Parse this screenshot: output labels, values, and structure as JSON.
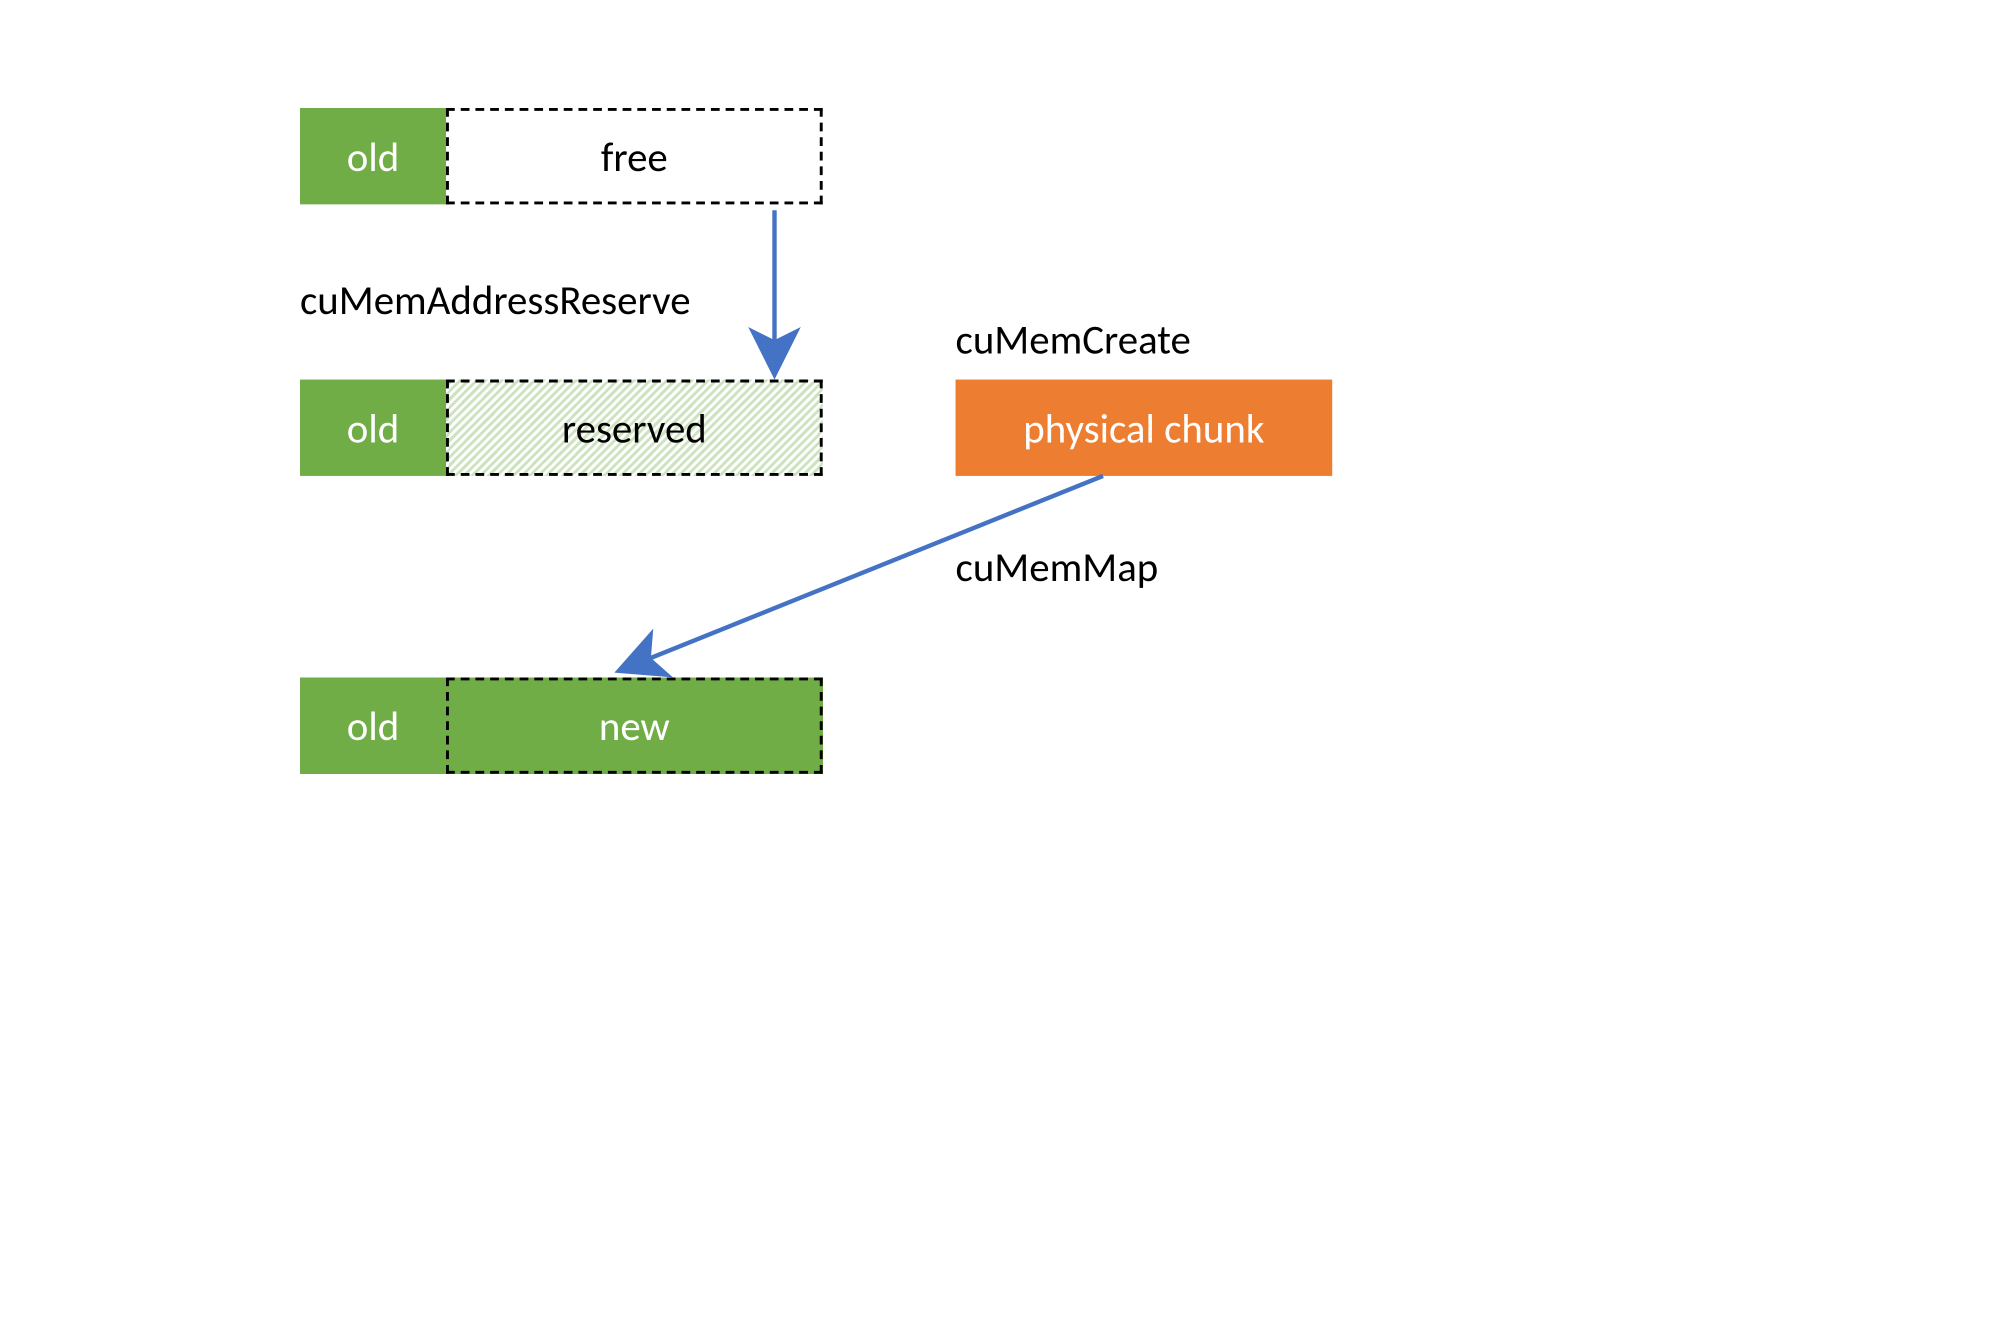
{
  "boxes": {
    "row1": {
      "old": "old",
      "free": "free"
    },
    "row2": {
      "old": "old",
      "reserved": "reserved"
    },
    "row3": {
      "old": "old",
      "new": "new"
    },
    "physical": "physical chunk"
  },
  "labels": {
    "reserve": "cuMemAddressReserve",
    "create": "cuMemCreate",
    "map": "cuMemMap"
  },
  "colors": {
    "green": "#70ad47",
    "orange": "#ed7d31",
    "arrow": "#4472c4"
  }
}
